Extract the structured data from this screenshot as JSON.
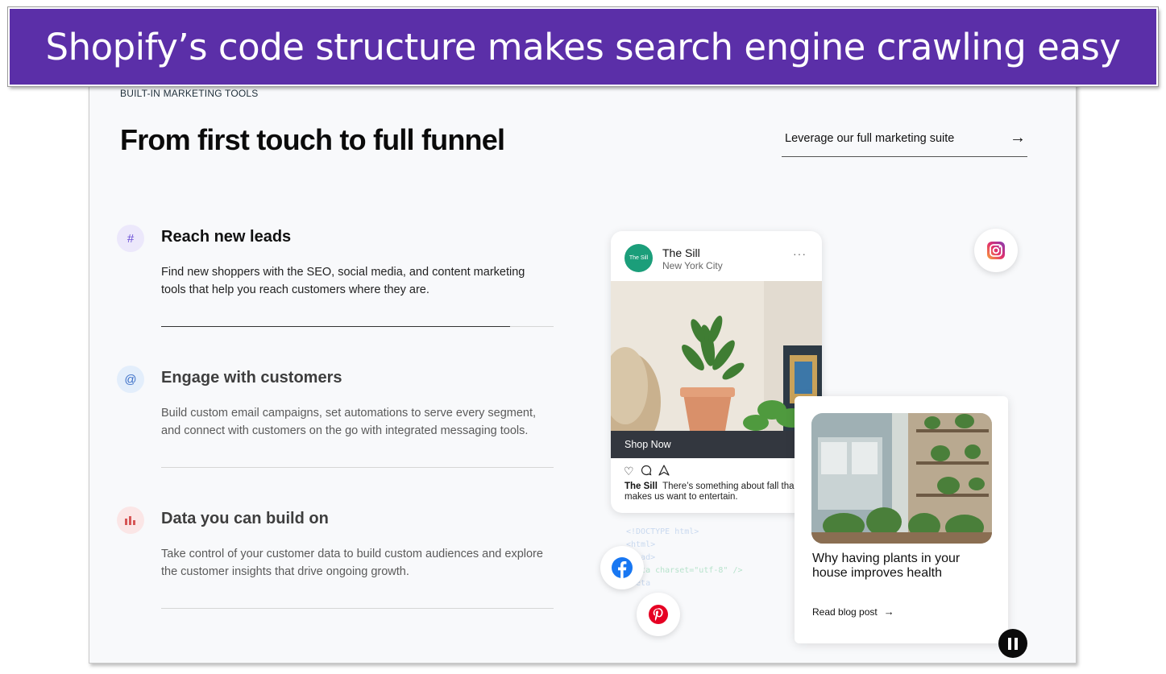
{
  "banner": {
    "text": "Shopify’s code structure makes search engine crawling easy"
  },
  "header": {
    "eyebrow": "BUILT-IN MARKETING TOOLS",
    "headline": "From first touch to full funnel",
    "suite_link": "Leverage our full marketing suite"
  },
  "features": [
    {
      "icon": "hash-icon",
      "icon_glyph": "#",
      "title": "Reach new leads",
      "description": "Find new shoppers with the SEO, social media, and content marketing tools that help you reach customers where they are.",
      "progress": 0.89,
      "active": true
    },
    {
      "icon": "at-sign-icon",
      "icon_glyph": "@",
      "title": "Engage with customers",
      "description": "Build custom email campaigns, set automations to serve every segment, and connect with customers on the go with integrated messaging tools.",
      "progress": 0,
      "active": false
    },
    {
      "icon": "bar-chart-icon",
      "icon_glyph": "▮▮",
      "title": "Data you can build on",
      "description": "Take control of your customer data to build custom audiences and explore the customer insights that drive ongoing growth.",
      "progress": 0,
      "active": false
    }
  ],
  "post": {
    "avatar_text": "The Sill",
    "name": "The Sill",
    "location": "New York City",
    "more": "···",
    "cta": "Shop Now",
    "caption_name": "The Sill",
    "caption_text": "There’s something about fall tha makes us want to entertain."
  },
  "code_lines": [
    "<!DOCTYPE html>",
    "<html>",
    "<head>",
    "<meta charset=\"utf-8\" />",
    "<meta"
  ],
  "blog": {
    "title": "Why having plants in your house improves health",
    "link": "Read blog post"
  },
  "colors": {
    "banner_bg": "#5b2fa8",
    "avatar_bg": "#1b9e7a",
    "facebook": "#1877f2",
    "pinterest": "#e60023",
    "instagram": "#d6249f"
  }
}
